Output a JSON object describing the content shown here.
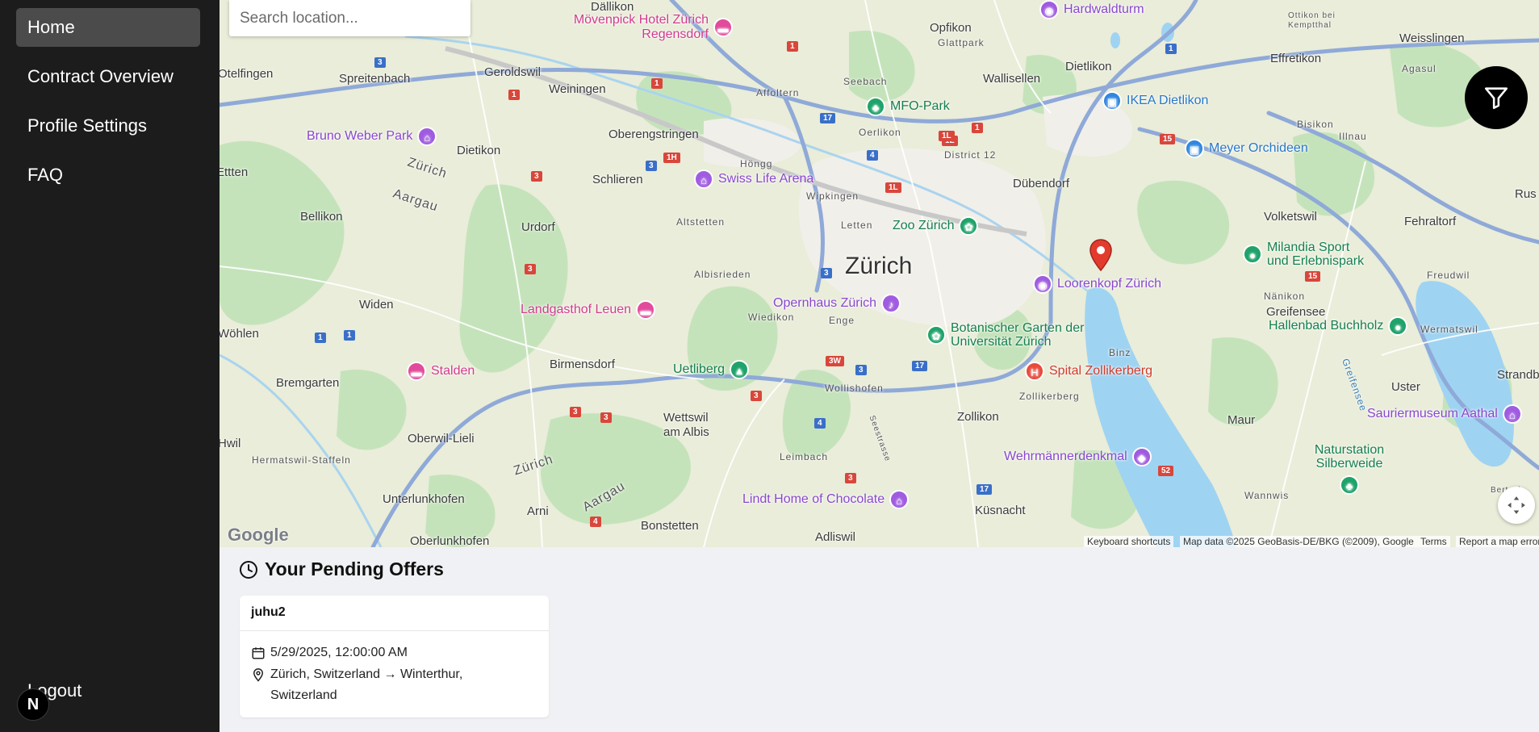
{
  "sidebar": {
    "items": [
      {
        "label": "Home",
        "active": true
      },
      {
        "label": "Contract Overview",
        "active": false
      },
      {
        "label": "Profile Settings",
        "active": false
      },
      {
        "label": "FAQ",
        "active": false
      }
    ],
    "logout_label": "Logout",
    "badge_letter": "N"
  },
  "map": {
    "search_placeholder": "Search location...",
    "city_label": "Zürich",
    "places": [
      "Dällikon",
      "Opfikon",
      "Otelfingen",
      "Spreitenbach",
      "Geroldswil",
      "Weiningen",
      "Oberengstringen",
      "Dietikon",
      "Schlieren",
      "Urdorf",
      "Bellikon",
      "Widen",
      "Bremgarten",
      "Birmensdorf",
      "Oberwil-Lieli",
      "Unterlunkhofen",
      "Oberlunkhofen",
      "Arni",
      "Bonstetten",
      "Wettswil am Albis",
      "Adliswil",
      "Küsnacht",
      "Zollikon",
      "Maur",
      "Uster",
      "Greifensee",
      "Volketswil",
      "Fehraltorf",
      "Dübendorf",
      "Wallisellen",
      "Dietlikon",
      "Effretikon",
      "Weisslingen",
      "Seebach",
      "Oerlikon",
      "Höngg",
      "Altstetten",
      "Wipkingen",
      "Letten",
      "Albisrieden",
      "Wiedikon",
      "Enge",
      "Wollishofen",
      "Leimbach",
      "Affoltern",
      "Glattpark",
      "District 12",
      "Binz",
      "Zollikerberg",
      "Nänikon",
      "Bisikon",
      "Illnau",
      "Freudwil",
      "Wermatswil",
      "Wannwis",
      "Hermatswil-Staffeln",
      "Ottikon bei Kemptthal",
      "Agasul",
      "Zürich",
      "Aargau",
      "Ettten",
      "Wöhlen",
      "Hwil",
      "Strandb",
      "Rus",
      "Bertsch"
    ],
    "pois": [
      {
        "label": "Mövenpick Hotel Zürich Regensdorf",
        "kind": "hotel"
      },
      {
        "label": "Hardwaldturm",
        "kind": "attraction"
      },
      {
        "label": "IKEA Dietlikon",
        "kind": "shop"
      },
      {
        "label": "Meyer Orchideen",
        "kind": "shop"
      },
      {
        "label": "MFO-Park",
        "kind": "park"
      },
      {
        "label": "Bruno Weber Park",
        "kind": "attraction"
      },
      {
        "label": "Swiss Life Arena",
        "kind": "attraction"
      },
      {
        "label": "Zoo Zürich",
        "kind": "park"
      },
      {
        "label": "Milandia Sport und Erlebnispark",
        "kind": "park"
      },
      {
        "label": "Loorenkopf Zürich",
        "kind": "attraction"
      },
      {
        "label": "Hallenbad Buchholz",
        "kind": "park"
      },
      {
        "label": "Landgasthof Leuen",
        "kind": "hotel"
      },
      {
        "label": "Opernhaus Zürich",
        "kind": "attraction"
      },
      {
        "label": "Botanischer Garten der Universität Zürich",
        "kind": "park"
      },
      {
        "label": "Stalden",
        "kind": "hotel"
      },
      {
        "label": "Uetliberg",
        "kind": "park"
      },
      {
        "label": "Spital Zollikerberg",
        "kind": "hospital"
      },
      {
        "label": "Sauriermuseum Aathal",
        "kind": "attraction"
      },
      {
        "label": "Naturstation Silberweide",
        "kind": "park"
      },
      {
        "label": "Wehrmännerdenkmal",
        "kind": "attraction"
      },
      {
        "label": "Lindt Home of Chocolate",
        "kind": "attraction"
      }
    ],
    "lake_labels": [
      "Greifensee",
      "Seestrasse"
    ],
    "road_shields": [
      "1",
      "3",
      "1H",
      "1L",
      "3W",
      "4",
      "15",
      "17",
      "52"
    ],
    "attribution": {
      "shortcuts": "Keyboard shortcuts",
      "data": "Map data ©2025 GeoBasis-DE/BKG (©2009), Google",
      "terms": "Terms",
      "report": "Report a map error"
    },
    "google_logo": "Google",
    "colors": {
      "land": "#e8ecd9",
      "forest": "#c3e2bb",
      "water": "#9dd2f0",
      "motorway": "#8fa7d6",
      "marker": "#e23b2e"
    }
  },
  "offers": {
    "heading": "Your Pending Offers",
    "items": [
      {
        "title": "juhu2",
        "date": "5/29/2025, 12:00:00 AM",
        "route": "Zürich, Switzerland → Winterthur, Switzerland"
      }
    ]
  }
}
